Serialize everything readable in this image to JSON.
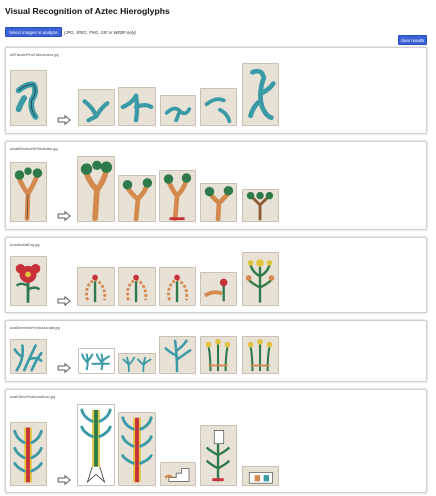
{
  "header": {
    "title": "Visual Recognition of Aztec Hieroglyphs",
    "select_label": "Select images to analyze",
    "hint": "(JPG, JPEG, PNG, GIF or WEBP only)",
    "clear_label": "clear results"
  },
  "results": [
    {
      "file": "at0TlacatelPeraTlalocAzteca.jpg"
    },
    {
      "file": "ahuatlEtmalochtliTetlaltoatla.jpg"
    },
    {
      "file": "AxacatlatlatlDay.jpg"
    },
    {
      "file": "acatlElementoFrentoAxacatla.jpg"
    },
    {
      "file": "acatlGlifosPeraAcacahuac.jpg"
    }
  ],
  "colors": {
    "accent": "#3b63d6",
    "thumb_bg": "#e7e1d6",
    "teal": "#3a9aa6",
    "green": "#2f7a4a",
    "brown": "#d48a4e",
    "red": "#c8313a",
    "yellow": "#e2c340"
  }
}
